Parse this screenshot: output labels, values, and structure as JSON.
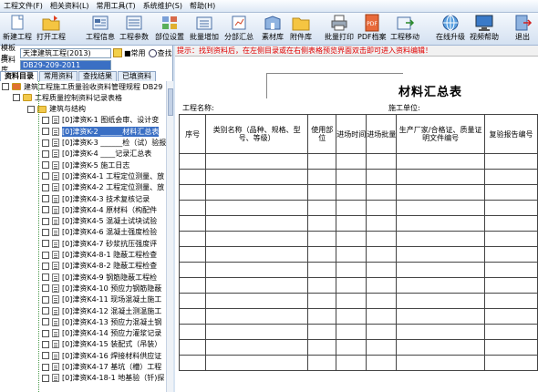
{
  "menu": [
    "工程文件(F)",
    "相关资料(L)",
    "常用工具(T)",
    "系统维护(S)",
    "帮助(H)"
  ],
  "toolbar": {
    "new_project": "新建工程",
    "open_project": "打开工程",
    "project_info": "工程信息",
    "project_params": "工程参数",
    "unit_settings": "部位设置",
    "batch_add": "批量增加",
    "sub_summary": "分部汇总",
    "material_lib": "素材库",
    "attachment_lib": "附件库",
    "batch_print": "批量打印",
    "pdf_archive": "PDF档案",
    "project_move": "工程移动",
    "online_upgrade": "在线升级",
    "video_help": "视频帮助",
    "exit": "退出"
  },
  "left": {
    "template_label": "模板库",
    "template_value": "天津建筑工程(2013)",
    "common_label": "■常用",
    "search_label": "查找",
    "material_label": "资料库",
    "material_value": "DB29-209-2011",
    "tabs": [
      "资料目录",
      "常用资料",
      "查找结果",
      "已填资料"
    ],
    "tree": [
      {
        "level": 0,
        "type": "root",
        "text": "建筑工程施工质量验收资料管理规程 DB29"
      },
      {
        "level": 1,
        "type": "folder",
        "text": "工程质量控制资料记录表格"
      },
      {
        "level": 2,
        "type": "folder",
        "text": "建筑与结构"
      },
      {
        "level": 3,
        "type": "doc",
        "text": "[0]津资K-1  图纸会审、设计变"
      },
      {
        "level": 3,
        "type": "doc",
        "text": "[0]津资K-2  ______材料汇总表",
        "selected": true
      },
      {
        "level": 3,
        "type": "doc",
        "text": "[0]津资K-3  ______检（试）验报"
      },
      {
        "level": 3,
        "type": "doc",
        "text": "[0]津资K-4  ____记录汇总表"
      },
      {
        "level": 3,
        "type": "doc",
        "text": "[0]津资K-5  施工日志"
      },
      {
        "level": 3,
        "type": "doc",
        "text": "[0]津资K4-1  工程定位测量、放"
      },
      {
        "level": 3,
        "type": "doc",
        "text": "[0]津资K4-2  工程定位测量、放"
      },
      {
        "level": 3,
        "type": "doc",
        "text": "[0]津资K4-3  技术复核记录"
      },
      {
        "level": 3,
        "type": "doc",
        "text": "[0]津资K4-4  原材料（构配件"
      },
      {
        "level": 3,
        "type": "doc",
        "text": "[0]津资K4-5  混凝土试块试验"
      },
      {
        "level": 3,
        "type": "doc",
        "text": "[0]津资K4-6  混凝土强度检验"
      },
      {
        "level": 3,
        "type": "doc",
        "text": "[0]津资K4-7  砂浆抗压强度评"
      },
      {
        "level": 3,
        "type": "doc",
        "text": "[0]津资K4-8-1  隐蔽工程检查"
      },
      {
        "level": 3,
        "type": "doc",
        "text": "[0]津资K4-8-2  隐蔽工程检查"
      },
      {
        "level": 3,
        "type": "doc",
        "text": "[0]津资K4-9  钢筋隐蔽工程检"
      },
      {
        "level": 3,
        "type": "doc",
        "text": "[0]津资K4-10  预应力钢筋隐蔽"
      },
      {
        "level": 3,
        "type": "doc",
        "text": "[0]津资K4-11  现场混凝土施工"
      },
      {
        "level": 3,
        "type": "doc",
        "text": "[0]津资K4-12  混凝土测温施工"
      },
      {
        "level": 3,
        "type": "doc",
        "text": "[0]津资K4-13  预应力混凝土钢"
      },
      {
        "level": 3,
        "type": "doc",
        "text": "[0]津资K4-14  预应力灌浆记录"
      },
      {
        "level": 3,
        "type": "doc",
        "text": "[0]津资K4-15  装配式（吊装）"
      },
      {
        "level": 3,
        "type": "doc",
        "text": "[0]津资K4-16  焊接材料供应证"
      },
      {
        "level": 3,
        "type": "doc",
        "text": "[0]津资K4-17  基坑（槽）工程"
      },
      {
        "level": 3,
        "type": "doc",
        "text": "[0]津资K4-18-1  地基验（钎)探"
      }
    ]
  },
  "right": {
    "hint": "提示：找到资料后，在左侧目录或在右侧表格预览界面双击即可进入资料编辑！",
    "title": "材料汇总表",
    "project_name_label": "工程名称:",
    "unit_label": "施工单位:",
    "columns": [
      "序号",
      "类别名称（品种、规格、型号、等级）",
      "使用部位",
      "进场时间",
      "进场批量",
      "生产厂家/合格证、质量证明文件编号",
      "复验报告编号"
    ],
    "empty_rows": 14
  }
}
